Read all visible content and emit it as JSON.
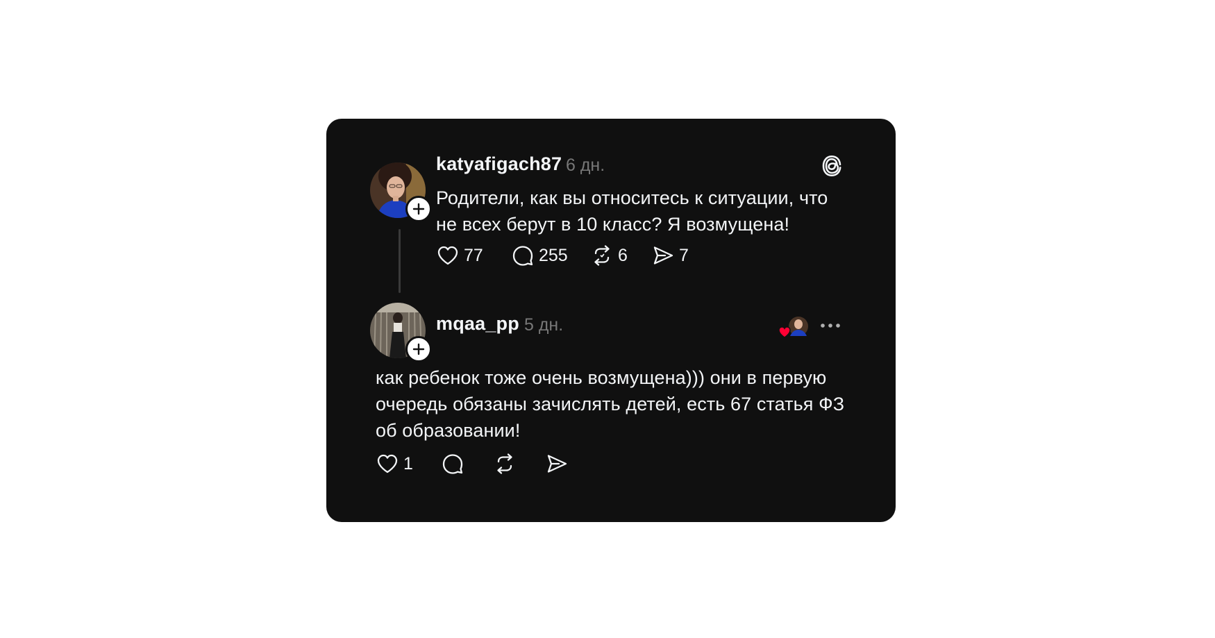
{
  "post": {
    "username": "katyafigach87",
    "time": "6 дн.",
    "text": "Родители, как вы относитесь к ситуации, что не всех берут в 10 класс? Я возмущена!",
    "likes": "77",
    "comments": "255",
    "reposts": "6",
    "shares": "7"
  },
  "reply": {
    "username": "mqaa_pp",
    "time": "5 дн.",
    "text": "как ребенок тоже очень возмущена))) они в первую очередь обязаны зачислять детей, есть 67 статья ФЗ об образовании!",
    "likes": "1"
  },
  "colors": {
    "card_background": "#101010",
    "text_primary": "#f3f5f7",
    "text_secondary": "#777777",
    "like_heart": "#ff0034"
  },
  "icons": {
    "threads_logo": "threads-logo-icon",
    "like": "heart-icon",
    "comment": "comment-bubble-icon",
    "repost": "repost-icon",
    "share": "share-send-icon",
    "more": "more-dots-icon",
    "follow": "plus-icon"
  }
}
